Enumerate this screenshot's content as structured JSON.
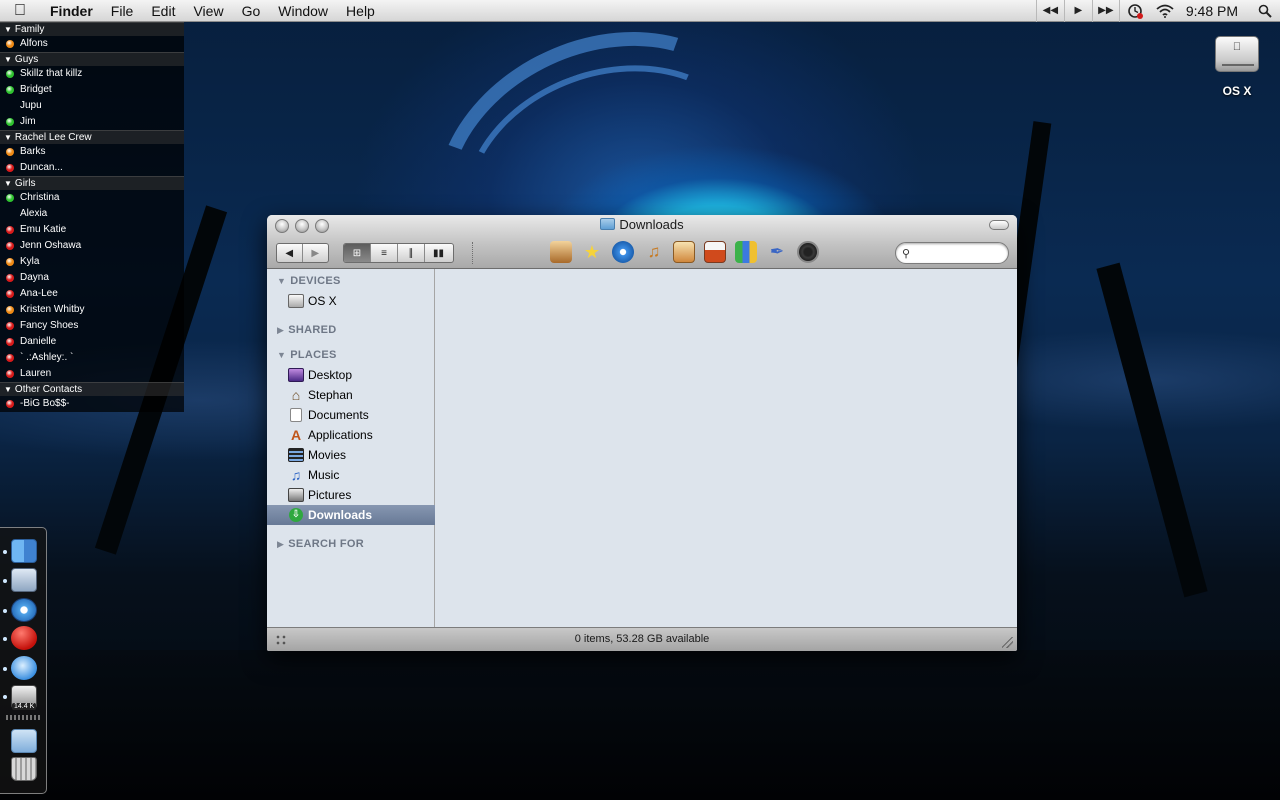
{
  "menubar": {
    "app_name": "Finder",
    "menus": [
      "File",
      "Edit",
      "View",
      "Go",
      "Window",
      "Help"
    ],
    "clock": "9:48 PM",
    "icons": [
      "apple-icon",
      "rewind-icon",
      "play-icon",
      "fast-forward-icon",
      "time-machine-icon",
      "wifi-icon",
      "spotlight-icon"
    ]
  },
  "buddylist": {
    "groups": [
      {
        "name": "Family",
        "buddies": [
          {
            "name": "Alfons",
            "status": "away"
          }
        ]
      },
      {
        "name": "Guys",
        "buddies": [
          {
            "name": "Skillz that killz",
            "status": "online"
          },
          {
            "name": "Bridget",
            "status": "online"
          },
          {
            "name": "Jupu",
            "status": "none"
          },
          {
            "name": "Jim",
            "status": "online"
          }
        ]
      },
      {
        "name": "Rachel Lee Crew",
        "buddies": [
          {
            "name": "Barks",
            "status": "away"
          },
          {
            "name": "Duncan...",
            "status": "busy"
          }
        ]
      },
      {
        "name": "Girls",
        "buddies": [
          {
            "name": "Christina",
            "status": "online"
          },
          {
            "name": "Alexia",
            "status": "none"
          },
          {
            "name": "Emu Katie",
            "status": "busy"
          },
          {
            "name": "Jenn Oshawa",
            "status": "busy"
          },
          {
            "name": "Kyla",
            "status": "away"
          },
          {
            "name": "Dayna",
            "status": "busy"
          },
          {
            "name": "Ana-Lee",
            "status": "busy"
          },
          {
            "name": "Kristen Whitby",
            "status": "away"
          },
          {
            "name": "Fancy Shoes",
            "status": "busy"
          },
          {
            "name": "Danielle",
            "status": "busy"
          },
          {
            "name": "` .:Ashley:. `",
            "status": "busy"
          },
          {
            "name": "Lauren",
            "status": "busy"
          }
        ]
      },
      {
        "name": "Other Contacts",
        "buddies": [
          {
            "name": "-BiG Bo$$-",
            "status": "busy"
          }
        ]
      }
    ],
    "status_colors": {
      "online": "#2fc42f",
      "away": "#f08a14",
      "busy": "#d91a1a"
    }
  },
  "desktop": {
    "drive_label": "OS X"
  },
  "dock": {
    "badge": "14.4 K",
    "items": [
      "finder-icon",
      "mail-icon",
      "safari-icon",
      "red-ball-icon",
      "itunes-icon",
      "activity-icon",
      "documents-folder-icon",
      "trash-icon"
    ]
  },
  "finder": {
    "title": "Downloads",
    "view_modes": [
      "icon-view",
      "list-view",
      "column-view",
      "cover-flow-view"
    ],
    "search_placeholder": "",
    "toolbar_icons": [
      "iphoto-icon",
      "imovie-star-icon",
      "idvd-icon",
      "garageband-icon",
      "iweb-icon",
      "keynote-icon",
      "numbers-icon",
      "pages-icon",
      "photo-booth-icon"
    ],
    "sidebar": {
      "devices_header": "DEVICES",
      "devices": [
        {
          "label": "OS X",
          "icon": "hard-drive-icon"
        }
      ],
      "shared_header": "SHARED",
      "places_header": "PLACES",
      "places": [
        {
          "label": "Desktop",
          "icon": "desktop-icon"
        },
        {
          "label": "Stephan",
          "icon": "home-icon"
        },
        {
          "label": "Documents",
          "icon": "documents-icon"
        },
        {
          "label": "Applications",
          "icon": "applications-icon"
        },
        {
          "label": "Movies",
          "icon": "movies-icon"
        },
        {
          "label": "Music",
          "icon": "music-icon"
        },
        {
          "label": "Pictures",
          "icon": "pictures-icon"
        },
        {
          "label": "Downloads",
          "icon": "downloads-icon",
          "selected": true
        }
      ],
      "search_header": "SEARCH FOR"
    },
    "status": "0 items, 53.28 GB available"
  }
}
